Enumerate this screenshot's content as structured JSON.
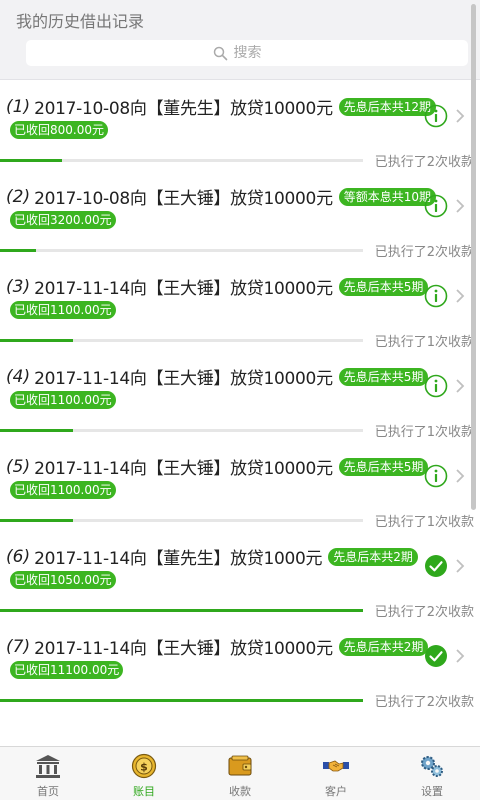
{
  "header": {
    "title": "我的历史借出记录"
  },
  "search": {
    "placeholder": "搜索"
  },
  "records": [
    {
      "index": "(1)",
      "text": "2017-10-08向【董先生】放贷10000元",
      "plan": "先息后本共12期",
      "received": "已收回800.00元",
      "exec": "已执行了2次收款",
      "progress": 0.17,
      "status": "pending"
    },
    {
      "index": "(2)",
      "text": "2017-10-08向【王大锤】放贷10000元",
      "plan": "等额本息共10期",
      "received": "已收回3200.00元",
      "exec": "已执行了2次收款",
      "progress": 0.1,
      "status": "pending"
    },
    {
      "index": "(3)",
      "text": "2017-11-14向【王大锤】放贷10000元",
      "plan": "先息后本共5期",
      "received": "已收回1100.00元",
      "exec": "已执行了1次收款",
      "progress": 0.2,
      "status": "pending"
    },
    {
      "index": "(4)",
      "text": "2017-11-14向【王大锤】放贷10000元",
      "plan": "先息后本共5期",
      "received": "已收回1100.00元",
      "exec": "已执行了1次收款",
      "progress": 0.2,
      "status": "pending"
    },
    {
      "index": "(5)",
      "text": "2017-11-14向【王大锤】放贷10000元",
      "plan": "先息后本共5期",
      "received": "已收回1100.00元",
      "exec": "已执行了1次收款",
      "progress": 0.2,
      "status": "pending"
    },
    {
      "index": "(6)",
      "text": "2017-11-14向【董先生】放贷1000元",
      "plan": "先息后本共2期",
      "received": "已收回1050.00元",
      "exec": "已执行了2次收款",
      "progress": 1.0,
      "status": "done"
    },
    {
      "index": "(7)",
      "text": "2017-11-14向【王大锤】放贷10000元",
      "plan": "先息后本共2期",
      "received": "已收回11100.00元",
      "exec": "已执行了2次收款",
      "progress": 1.0,
      "status": "done"
    }
  ],
  "tabs": [
    {
      "label": "首页",
      "icon": "bank-icon",
      "active": false
    },
    {
      "label": "账目",
      "icon": "coin-icon",
      "active": true
    },
    {
      "label": "收款",
      "icon": "wallet-icon",
      "active": false
    },
    {
      "label": "客户",
      "icon": "handshake-icon",
      "active": false
    },
    {
      "label": "设置",
      "icon": "gears-icon",
      "active": false
    }
  ],
  "colors": {
    "accent": "#2fa81c",
    "badge": "#3cb521",
    "track": "#e6e6e6",
    "text": "#222222",
    "muted": "#888888"
  }
}
